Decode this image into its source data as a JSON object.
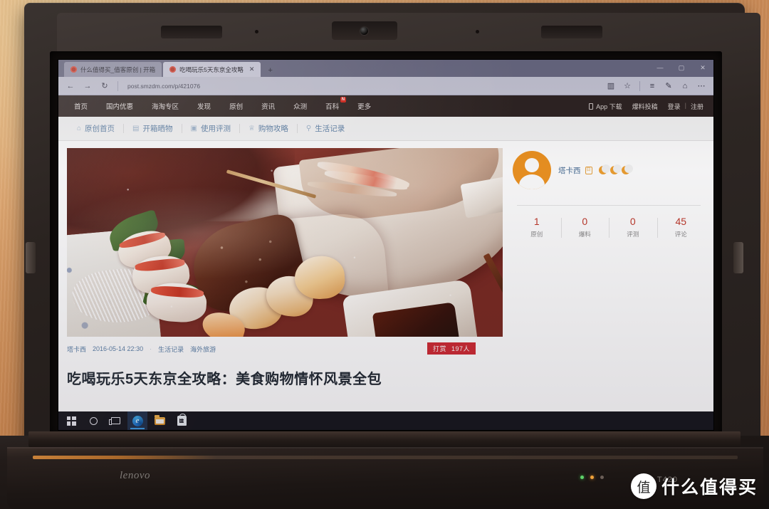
{
  "browser": {
    "tabs": [
      {
        "title": "什么值得买_值客原创 | 开箱",
        "active": false
      },
      {
        "title": "吃喝玩乐5天东京全攻略",
        "active": true
      }
    ],
    "new_tab_label": "+",
    "tab_close_label": "✕",
    "window_controls": {
      "minimize": "—",
      "maximize": "▢",
      "close": "✕"
    },
    "nav": {
      "back": "←",
      "forward": "→",
      "refresh": "↻"
    },
    "url": "post.smzdm.com/p/421076",
    "url_domain": "smzdm.com",
    "url_prefix": "post.",
    "url_suffix": "/p/421076",
    "toolbar_icons": [
      "reading-view-icon",
      "favorites-star-icon",
      "hub-icon",
      "web-note-icon",
      "share-icon",
      "more-icon"
    ]
  },
  "site": {
    "top_nav": [
      {
        "label": "首页",
        "badge": ""
      },
      {
        "label": "国内优惠",
        "badge": ""
      },
      {
        "label": "海淘专区",
        "badge": ""
      },
      {
        "label": "发现",
        "badge": ""
      },
      {
        "label": "原创",
        "badge": ""
      },
      {
        "label": "资讯",
        "badge": ""
      },
      {
        "label": "众测",
        "badge": ""
      },
      {
        "label": "百科",
        "badge": "N"
      },
      {
        "label": "更多",
        "badge": ""
      }
    ],
    "top_nav_right": {
      "app_download": "App 下载",
      "submit": "爆料投稿",
      "login": "登录",
      "separator": "|",
      "register": "注册"
    },
    "sub_nav": [
      {
        "label": "原创首页",
        "icon": "home-icon",
        "glyph": "⌂"
      },
      {
        "label": "开箱晒物",
        "icon": "box-icon",
        "glyph": "▤"
      },
      {
        "label": "使用评测",
        "icon": "camera-icon",
        "glyph": "▣"
      },
      {
        "label": "购物攻略",
        "icon": "cart-icon",
        "glyph": "♕"
      },
      {
        "label": "生活记录",
        "icon": "pin-icon",
        "glyph": "⚲"
      }
    ]
  },
  "article": {
    "author": "塔卡西",
    "timestamp": "2016-05-14 22:30",
    "separator": "·",
    "category": "生活记录",
    "tag": "海外旅游",
    "reward_label": "打赏",
    "reward_count": "197人",
    "title": "吃喝玩乐5天东京全攻略：美食购物情怀风景全包",
    "hero_alt": "japanese-sashimi-platter-photo"
  },
  "user_card": {
    "name": "塔卡西",
    "badge_glyph": "日",
    "level_icons": 3,
    "stats": [
      {
        "value": "1",
        "label": "原创"
      },
      {
        "value": "0",
        "label": "爆料"
      },
      {
        "value": "0",
        "label": "评测"
      },
      {
        "value": "45",
        "label": "评论"
      }
    ]
  },
  "taskbar": {
    "items": [
      {
        "name": "start-button",
        "label": ""
      },
      {
        "name": "cortana-button",
        "label": ""
      },
      {
        "name": "task-view-button",
        "label": ""
      },
      {
        "name": "edge-button",
        "label": ""
      },
      {
        "name": "file-explorer-button",
        "label": ""
      },
      {
        "name": "store-button",
        "label": ""
      }
    ]
  },
  "hardware": {
    "brand": "lenovo",
    "model": "T420",
    "thinkvantage": ""
  },
  "watermark": {
    "mark": "值",
    "text": "什么值得买"
  },
  "colors": {
    "nav_bg": "#2e2422",
    "accent_red": "#c0392b",
    "reward_red": "#cf2b33",
    "link_blue": "#5b7fa6",
    "avatar_orange": "#ef9421",
    "badge_red": "#d9261c"
  }
}
